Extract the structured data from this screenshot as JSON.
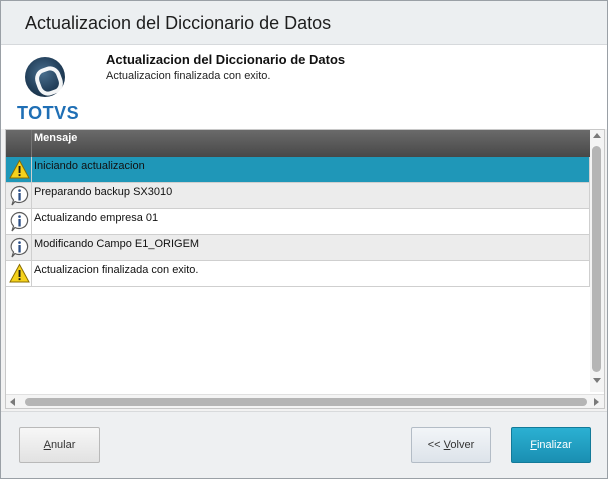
{
  "window": {
    "title": "Actualizacion del Diccionario de Datos"
  },
  "header": {
    "logo_text": "TOTVS",
    "title": "Actualizacion del Diccionario de Datos",
    "subtitle": "Actualizacion finalizada con exito."
  },
  "grid": {
    "column_header": "Mensaje",
    "rows": [
      {
        "icon": "warning-icon",
        "message": "Iniciando actualizacion",
        "selected": true
      },
      {
        "icon": "info-icon",
        "message": "Preparando backup SX3010",
        "selected": false
      },
      {
        "icon": "info-icon",
        "message": "Actualizando empresa 01",
        "selected": false
      },
      {
        "icon": "info-icon",
        "message": "Modificando Campo E1_ORIGEM",
        "selected": false
      },
      {
        "icon": "warning-icon",
        "message": "Actualizacion finalizada con exito.",
        "selected": false
      }
    ]
  },
  "footer": {
    "anular": {
      "prefix": "",
      "hotkey": "A",
      "rest": "nular"
    },
    "volver": {
      "prefix": "<< ",
      "hotkey": "V",
      "rest": "olver"
    },
    "finalizar": {
      "prefix": "",
      "hotkey": "F",
      "rest": "inalizar"
    }
  },
  "colors": {
    "selected_row": "#1f97b8",
    "header_bar": "#555555",
    "brand_blue": "#1f6fb5",
    "primary_button": "#1f9cc0"
  }
}
